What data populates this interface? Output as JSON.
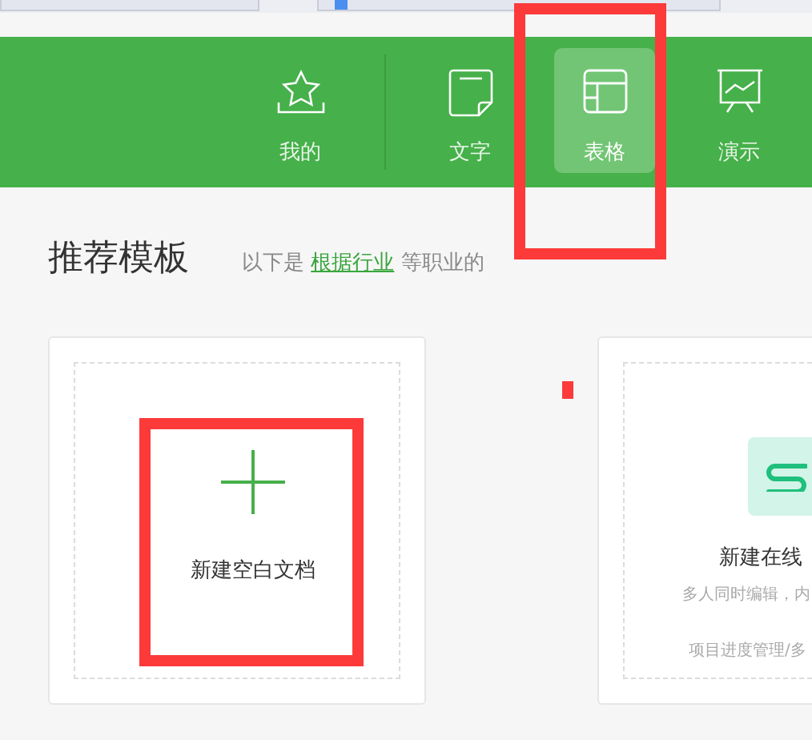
{
  "nav": [
    {
      "kind": "mine",
      "label": "我的",
      "selected": false,
      "highlighted": false
    },
    {
      "kind": "text",
      "label": "文字",
      "selected": false,
      "highlighted": false
    },
    {
      "kind": "sheet",
      "label": "表格",
      "selected": true,
      "highlighted": true
    },
    {
      "kind": "slides",
      "label": "演示",
      "selected": false,
      "highlighted": false
    }
  ],
  "section": {
    "title": "推荐模板",
    "intro": "以下是",
    "link": "根据行业",
    "rest": "等职业的"
  },
  "cards": [
    {
      "kind": "blank",
      "label": "新建空白文档",
      "highlighted": true
    },
    {
      "kind": "online",
      "title": "新建在线",
      "description": "多人同时编辑，内",
      "note": "项目进度管理/多"
    }
  ],
  "annotation_dot": true
}
